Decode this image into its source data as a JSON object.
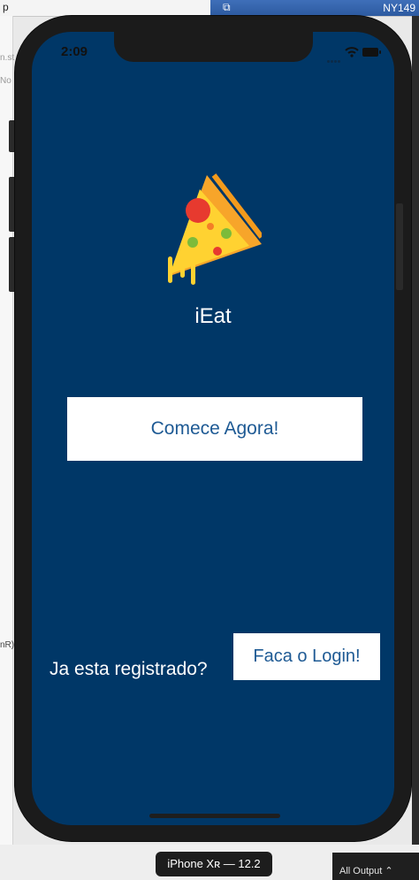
{
  "host": {
    "top_left_text": "p",
    "tab_label": "NY149",
    "left_hint_1": "n.st",
    "left_hint_2": "No",
    "left_hint_3": "nR)",
    "output_label": "All Output ⌃"
  },
  "simulator": {
    "device_label": "iPhone Xʀ — 12.2"
  },
  "status_bar": {
    "time": "2:09"
  },
  "app": {
    "title": "iEat",
    "start_button_label": "Comece Agora!",
    "registered_text": "Ja esta registrado?",
    "login_button_label": "Faca o Login!"
  },
  "colors": {
    "screen_background": "#003767",
    "button_text": "#1e5a94",
    "button_background": "#ffffff"
  }
}
